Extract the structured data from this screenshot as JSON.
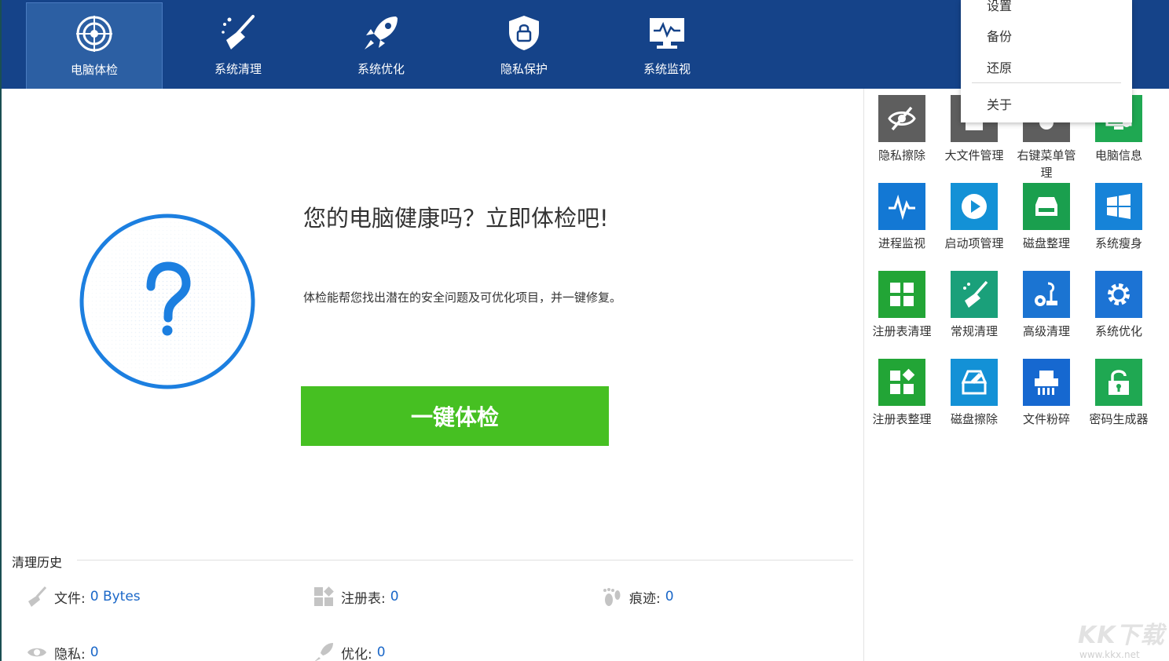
{
  "nav": {
    "tabs": [
      {
        "label": "电脑体检",
        "icon": "target-icon",
        "active": true
      },
      {
        "label": "系统清理",
        "icon": "broom-icon",
        "active": false
      },
      {
        "label": "系统优化",
        "icon": "rocket-icon",
        "active": false
      },
      {
        "label": "隐私保护",
        "icon": "shield-lock-icon",
        "active": false
      },
      {
        "label": "系统监视",
        "icon": "monitor-pulse-icon",
        "active": false
      }
    ]
  },
  "menu": {
    "items": [
      "设置",
      "备份",
      "还原",
      "关于"
    ]
  },
  "main": {
    "headline": "您的电脑健康吗？立即体检吧!",
    "subline": "体检能帮您找出潜在的安全问题及可优化项目，并一键修复。",
    "check_button": "一键体检",
    "history": {
      "title": "清理历史",
      "stats": [
        {
          "label": "文件:",
          "value": "0 Bytes",
          "icon": "broom-icon"
        },
        {
          "label": "注册表:",
          "value": "0",
          "icon": "registry-icon"
        },
        {
          "label": "痕迹:",
          "value": "0",
          "icon": "footprint-icon"
        },
        {
          "label": "隐私:",
          "value": "0",
          "icon": "eye-icon"
        },
        {
          "label": "优化:",
          "value": "0",
          "icon": "rocket-icon"
        }
      ]
    }
  },
  "tools": [
    {
      "label": "隐私擦除",
      "icon": "eye-slash-icon",
      "color": "#5e5e5e"
    },
    {
      "label": "大文件管理",
      "icon": "file-icon",
      "color": "#5e5e5e"
    },
    {
      "label": "右键菜单管理",
      "icon": "mouse-icon",
      "color": "#5e5e5e"
    },
    {
      "label": "电脑信息",
      "icon": "computer-info-icon",
      "color": "#1fa852"
    },
    {
      "label": "进程监视",
      "icon": "pulse-icon",
      "color": "#1378d4"
    },
    {
      "label": "启动项管理",
      "icon": "play-icon",
      "color": "#1391d6"
    },
    {
      "label": "磁盘整理",
      "icon": "disk-icon",
      "color": "#1a9f4e"
    },
    {
      "label": "系统瘦身",
      "icon": "windows-icon",
      "color": "#1683d8"
    },
    {
      "label": "注册表清理",
      "icon": "grid-icon",
      "color": "#22a536"
    },
    {
      "label": "常规清理",
      "icon": "broom-icon",
      "color": "#1aa07a"
    },
    {
      "label": "高级清理",
      "icon": "vacuum-icon",
      "color": "#1b74d2"
    },
    {
      "label": "系统优化",
      "icon": "gear-icon",
      "color": "#1c73d4"
    },
    {
      "label": "注册表整理",
      "icon": "registry-icon",
      "color": "#22a536"
    },
    {
      "label": "磁盘擦除",
      "icon": "disk-erase-icon",
      "color": "#1391d6"
    },
    {
      "label": "文件粉碎",
      "icon": "shredder-icon",
      "color": "#1668d0"
    },
    {
      "label": "密码生成器",
      "icon": "lock-icon",
      "color": "#1fa852"
    }
  ],
  "watermark": {
    "text": "KK下载",
    "url": "www.kkx.net"
  }
}
